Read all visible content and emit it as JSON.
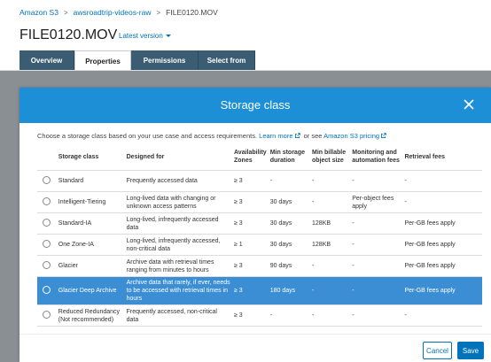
{
  "breadcrumb": {
    "items": [
      "Amazon S3",
      "awsroadtrip-videos-raw",
      "FILE0120.MOV"
    ],
    "separator": ">"
  },
  "page": {
    "title": "FILE0120.MOV",
    "version_label": "Latest version"
  },
  "tabs": [
    {
      "label": "Overview",
      "active": false
    },
    {
      "label": "Properties",
      "active": true
    },
    {
      "label": "Permissions",
      "active": false
    },
    {
      "label": "Select from",
      "active": false
    }
  ],
  "modal": {
    "title": "Storage class",
    "intro_text": "Choose a storage class based on your use case and access requirements.",
    "learn_more": "Learn more",
    "or_see": "or see",
    "pricing_link": "Amazon S3 pricing",
    "columns": [
      "Storage class",
      "Designed for",
      "Availability Zones",
      "Min storage duration",
      "Min billable object size",
      "Monitoring and automation fees",
      "Retrieval fees"
    ],
    "rows": [
      {
        "name": "Standard",
        "designed_for": "Frequently accessed data",
        "az": "≥ 3",
        "min_duration": "-",
        "min_size": "-",
        "monitoring": "-",
        "retrieval": "-",
        "selected": false
      },
      {
        "name": "Intelligent-Tiering",
        "designed_for": "Long-lived data with changing or unknown access patterns",
        "az": "≥ 3",
        "min_duration": "30 days",
        "min_size": "-",
        "monitoring": "Per-object fees apply",
        "retrieval": "-",
        "selected": false
      },
      {
        "name": "Standard-IA",
        "designed_for": "Long-lived, infrequently accessed data",
        "az": "≥ 3",
        "min_duration": "30 days",
        "min_size": "128KB",
        "monitoring": "-",
        "retrieval": "Per-GB fees apply",
        "selected": false
      },
      {
        "name": "One Zone-IA",
        "designed_for": "Long-lived, infrequently accessed, non-critical data",
        "az": "≥ 1",
        "min_duration": "30 days",
        "min_size": "128KB",
        "monitoring": "-",
        "retrieval": "Per-GB fees apply",
        "selected": false
      },
      {
        "name": "Glacier",
        "designed_for": "Archive data with retrieval times ranging from minutes to hours",
        "az": "≥ 3",
        "min_duration": "90 days",
        "min_size": "-",
        "monitoring": "-",
        "retrieval": "Per-GB fees apply",
        "selected": false
      },
      {
        "name": "Glacier Deep Archive",
        "designed_for": "Archive data that rarely, if ever, needs to be accessed with retrieval times in hours",
        "az": "≥ 3",
        "min_duration": "180 days",
        "min_size": "-",
        "monitoring": "-",
        "retrieval": "Per-GB fees apply",
        "selected": true
      },
      {
        "name": "Reduced Redundancy (Not recommended)",
        "designed_for": "Frequently accessed, non-critical data",
        "az": "≥ 3",
        "min_duration": "-",
        "min_size": "-",
        "monitoring": "-",
        "retrieval": "-",
        "selected": false
      }
    ],
    "cancel_label": "Cancel",
    "save_label": "Save"
  },
  "colors": {
    "header_blue": "#1c8fd6",
    "selected_row": "#3b8ed3",
    "link": "#0073bb",
    "tab_dark": "#3a5d73",
    "overlay": "#8a8f93"
  }
}
